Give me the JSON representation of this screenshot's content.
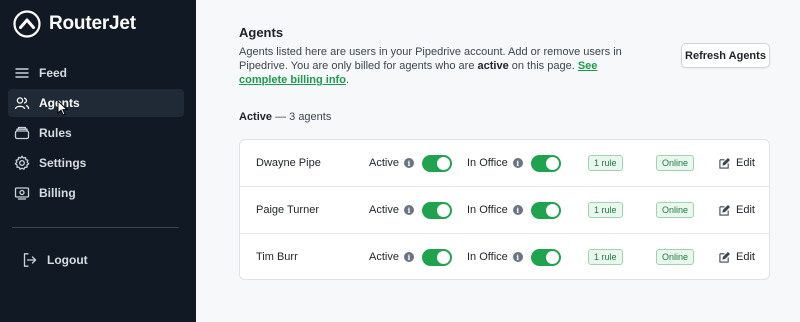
{
  "brand": {
    "name": "RouterJet"
  },
  "sidebar": {
    "items": [
      {
        "label": "Feed",
        "icon": "list-icon"
      },
      {
        "label": "Agents",
        "icon": "users-icon",
        "active": true
      },
      {
        "label": "Rules",
        "icon": "layers-icon"
      },
      {
        "label": "Settings",
        "icon": "gear-icon"
      },
      {
        "label": "Billing",
        "icon": "billing-icon"
      }
    ],
    "logout_label": "Logout"
  },
  "main": {
    "title": "Agents",
    "desc_prefix": "Agents listed here are users in your Pipedrive account. Add or remove users in Pipedrive. You are only billed for agents who are ",
    "desc_bold": "active",
    "desc_middle": " on this page. ",
    "desc_link": "See complete billing info",
    "desc_suffix": ".",
    "refresh_label": "Refresh Agents",
    "active_label": "Active",
    "active_count_text": " — 3 agents"
  },
  "table": {
    "rows": [
      {
        "name": "Dwayne Pipe",
        "active_label": "Active",
        "active_on": true,
        "office_label": "In Office",
        "office_on": true,
        "rule": "1 rule",
        "status": "Online",
        "edit_label": "Edit"
      },
      {
        "name": "Paige Turner",
        "active_label": "Active",
        "active_on": true,
        "office_label": "In Office",
        "office_on": true,
        "rule": "1 rule",
        "status": "Online",
        "edit_label": "Edit"
      },
      {
        "name": "Tim Burr",
        "active_label": "Active",
        "active_on": true,
        "office_label": "In Office",
        "office_on": true,
        "rule": "1 rule",
        "status": "Online",
        "edit_label": "Edit"
      }
    ]
  },
  "colors": {
    "sidebar_bg": "#111a24",
    "accent_green": "#1fa34f",
    "link_green": "#1a9e4b"
  }
}
